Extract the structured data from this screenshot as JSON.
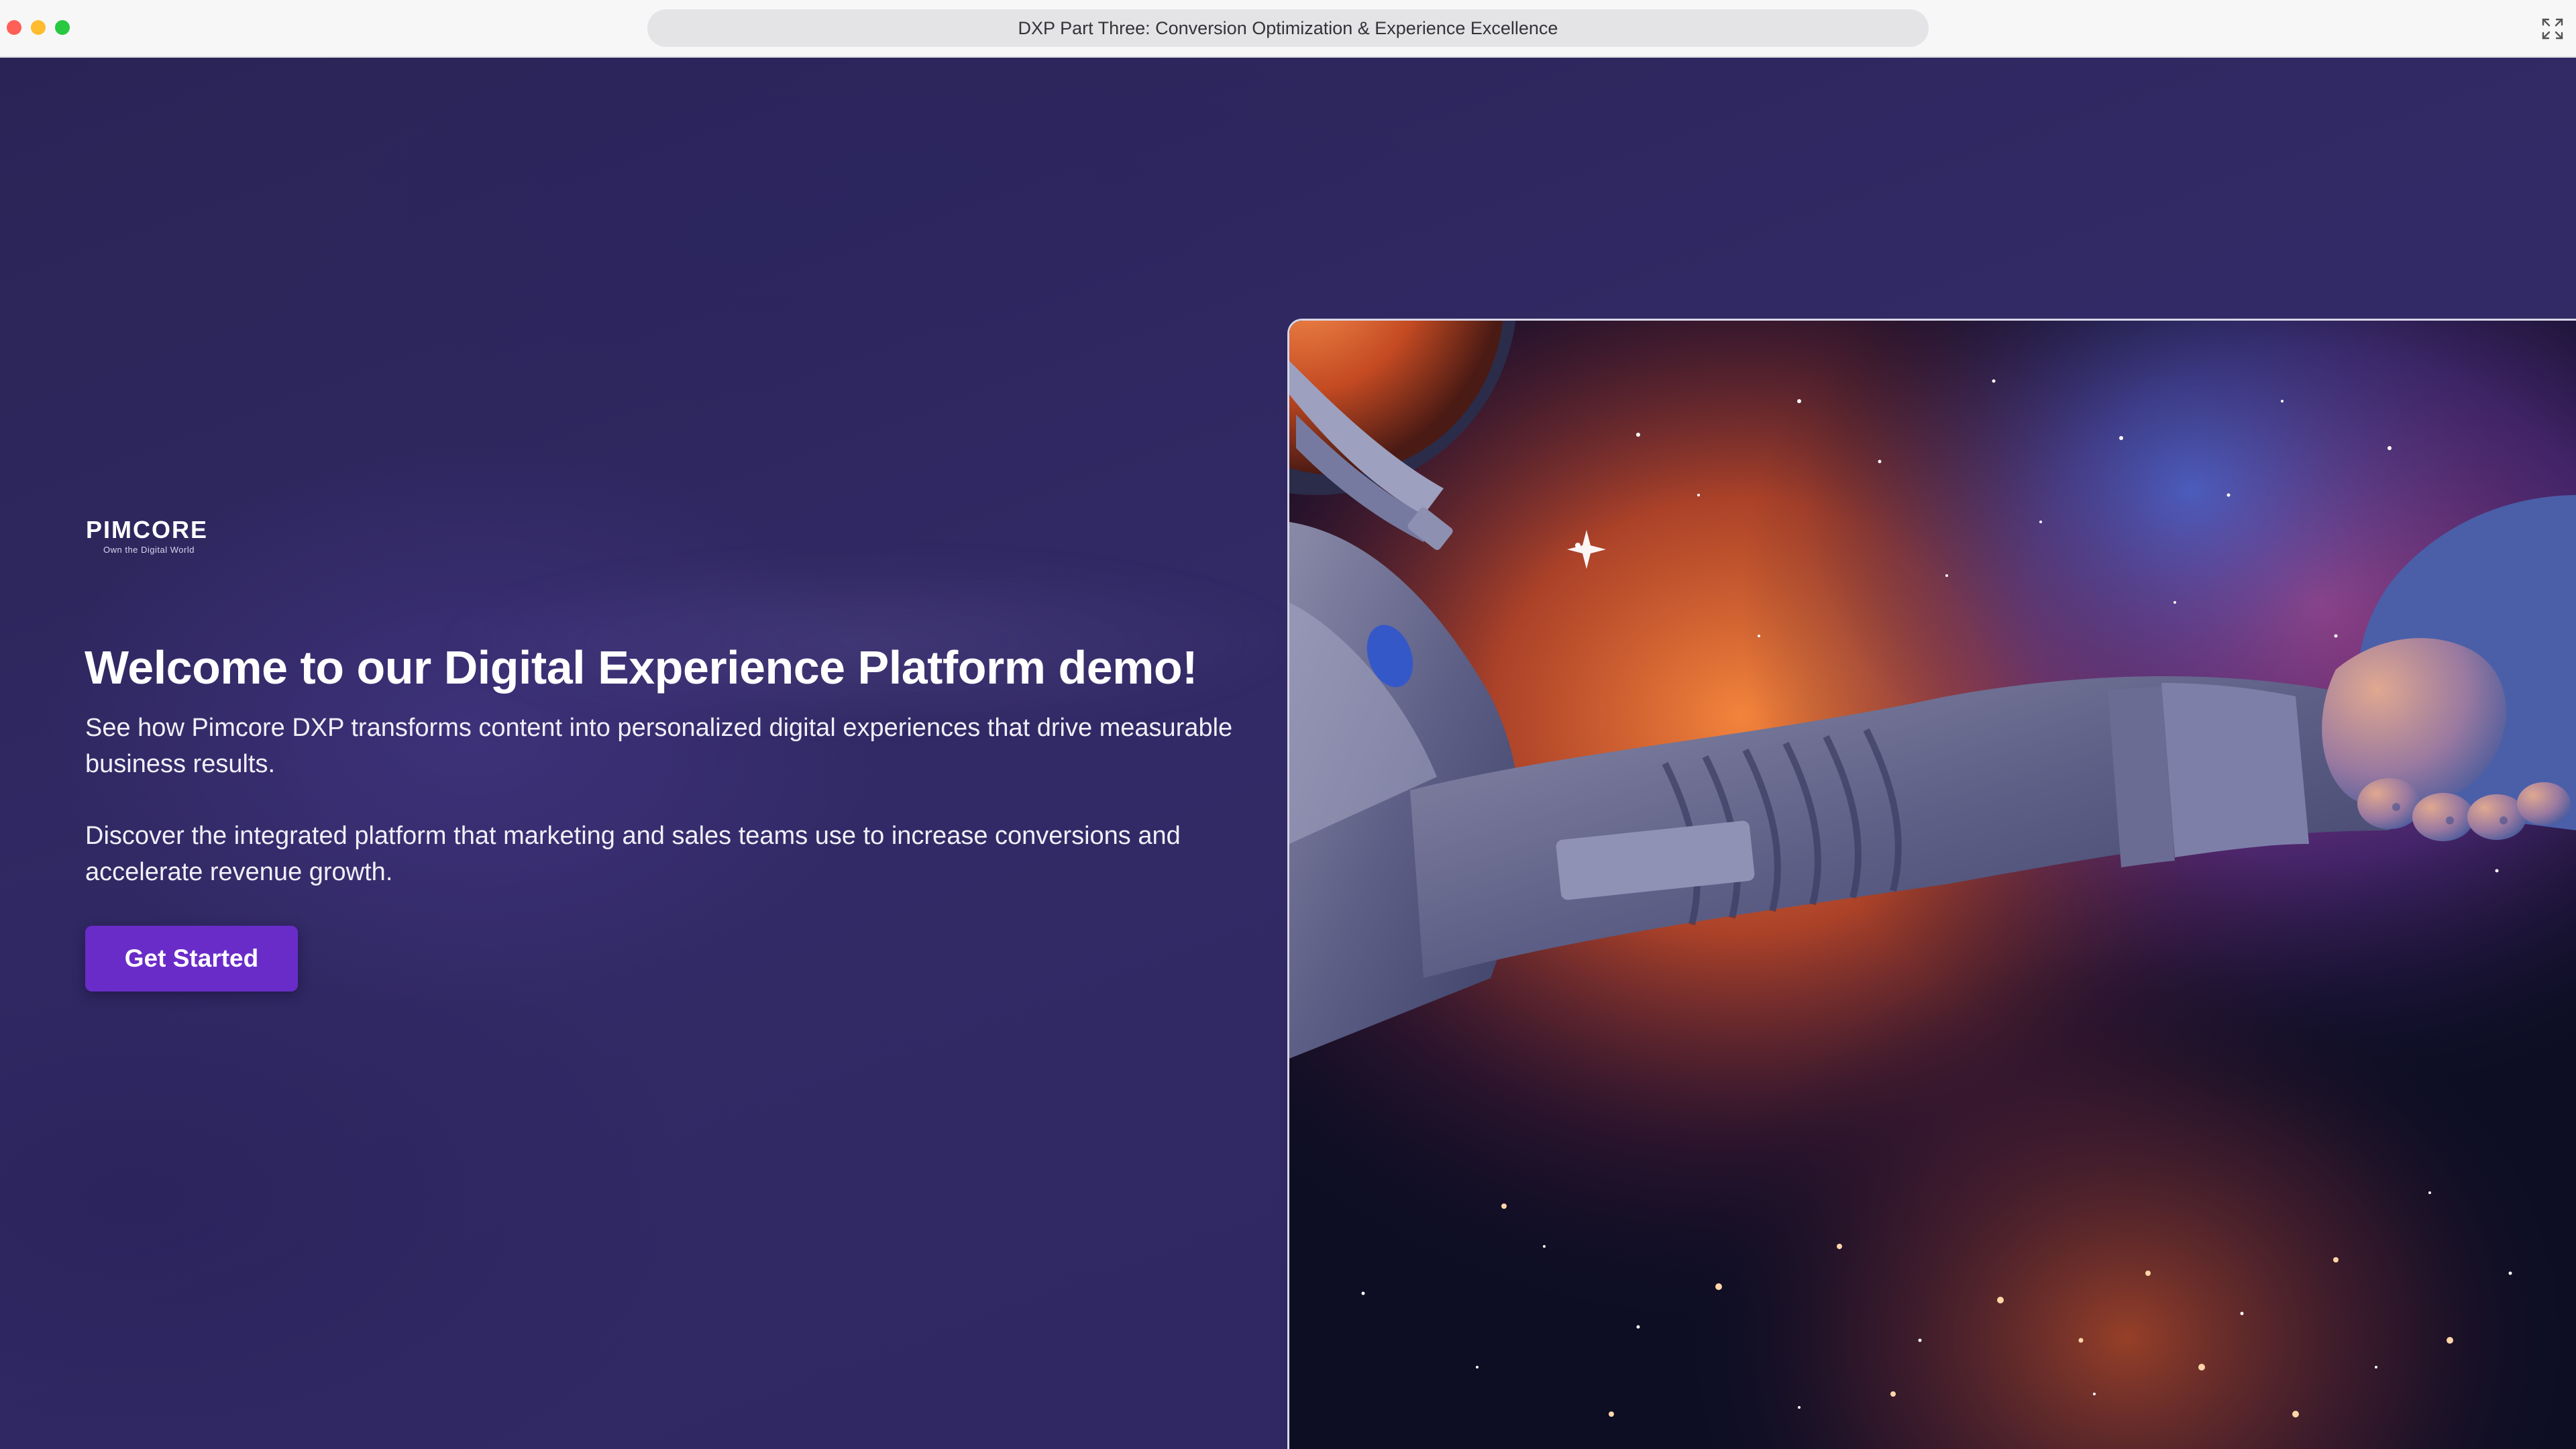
{
  "window": {
    "title": "DXP Part Three: Conversion Optimization & Experience Excellence"
  },
  "brand": {
    "name": "PIMCORE",
    "tagline": "Own the Digital World"
  },
  "hero": {
    "headline": "Welcome to our Digital Experience Platform demo!",
    "paragraph_1": "See how Pimcore DXP transforms content into personalized digital experiences that drive measurable business results.",
    "paragraph_2": "Discover the integrated platform that marketing and sales teams use to increase conversions and accelerate revenue growth.",
    "cta_label": "Get Started"
  },
  "colors": {
    "background": "#2e2759",
    "cta": "#6a2cc9",
    "text": "#ffffff"
  },
  "icons": {
    "window_controls": [
      "close-icon",
      "minimize-icon",
      "zoom-icon"
    ],
    "fullscreen": "fullscreen-icon"
  }
}
